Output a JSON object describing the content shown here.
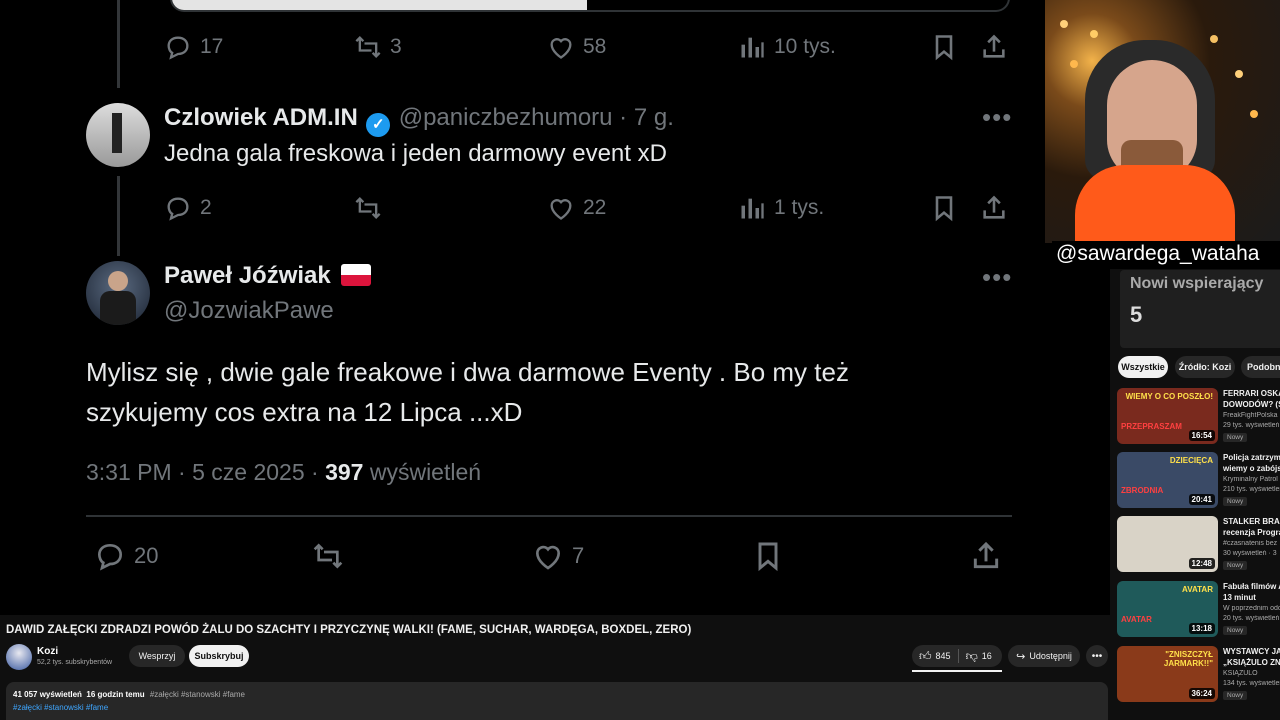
{
  "tweets": {
    "first_actions": {
      "replies": "17",
      "retweets": "3",
      "likes": "58",
      "views": "10 tys."
    },
    "reply1": {
      "name": "Czlowiek ADM.IN",
      "handle_time": "@paniczbezhumoru · 7 g.",
      "text": "Jedna gala freskowa i jeden darmowy event xD",
      "replies": "2",
      "retweets": "",
      "likes": "22",
      "views": "1 tys."
    },
    "main": {
      "name": "Paweł Jóźwiak",
      "handle": "@JozwiakPawe",
      "text_line1": "Mylisz się , dwie gale freakowe i dwa darmowe Eventy . Bo my też",
      "text_line2": "szykujemy cos extra na 12 Lipca ...xD",
      "timestamp": "3:31 PM · 5 cze 2025 · ",
      "views_count": "397",
      "views_label": " wyświetleń",
      "replies": "20",
      "likes": "7"
    }
  },
  "webcam": {
    "handle": "@sawardega_wataha"
  },
  "stream_widget": {
    "label": "Nowi wspierający",
    "count": "5"
  },
  "video": {
    "title": "DAWID ZAŁĘCKI ZDRADZI POWÓD ŻALU DO SZACHTY I PRZYCZYNĘ WALKI! (FAME, SUCHAR, WARDĘGA, BOXDEL, ZERO)",
    "channel_name": "Kozi",
    "subscribers": "52,2 tys. subskrybentów",
    "support_label": "Wesprzyj",
    "subscribe_label": "Subskrybuj",
    "likes": "845",
    "dislikes": "16",
    "share_label": "Udostępnij",
    "views_time": "41 057 wyświetleń  16 godzin temu",
    "desc_tags": "#załęcki #stanowski #fame",
    "tags": "#załęcki #stanowski #fame"
  },
  "filters": [
    "Wszystkie",
    "Źródło: Kozi",
    "Podobne"
  ],
  "recommendations": [
    {
      "title": "FERRARI OSKA",
      "title2": "DOWODÓW? (S",
      "channel": "FreakFightPolska",
      "meta": "29 tys. wyświetleń",
      "badge": "Nowy",
      "duration": "16:54",
      "thumb_text": "WIEMY O CO POSZŁO!",
      "thumb_text2": "PRZEPRASZAM",
      "color": "#7a2a1e"
    },
    {
      "title": "Policja zatrzym",
      "title2": "wiemy o zabójs",
      "channel": "Kryminalny Patrol",
      "meta": "210 tys. wyświetleń",
      "badge": "Nowy",
      "duration": "20:41",
      "thumb_text": "DZIECIĘCA",
      "thumb_text2": "ZBRODNIA",
      "color": "#3a4a66"
    },
    {
      "title": "STALKER BRAZ",
      "title2": "recenzja Progra",
      "channel": "#czasnatenis bez",
      "meta": "30 wyświetleń · 3",
      "badge": "Nowy",
      "duration": "12:48",
      "thumb_text": "",
      "thumb_text2": "",
      "color": "#d9d3c7"
    },
    {
      "title": "Fabuła filmów A",
      "title2": "13 minut",
      "channel": "W poprzednim odc",
      "meta": "20 tys. wyświetleń",
      "badge": "Nowy",
      "duration": "13:18",
      "thumb_text": "AVATAR",
      "thumb_text2": "AVATAR",
      "color": "#1f5a5a"
    },
    {
      "title": "WYSTAWCY JA",
      "title2": "„KSIĄŻULO ZNI",
      "channel": "KSIĄŻULO",
      "meta": "134 tys. wyświetleń",
      "badge": "Nowy",
      "duration": "36:24",
      "thumb_text": "\"ZNISZCZYŁ JARMARK!!\"",
      "thumb_text2": "",
      "color": "#8a3a1a"
    }
  ],
  "colors": {
    "twitter_blue": "#1d9bf0",
    "bg": "#0f0f0f",
    "muted": "#71767b"
  }
}
